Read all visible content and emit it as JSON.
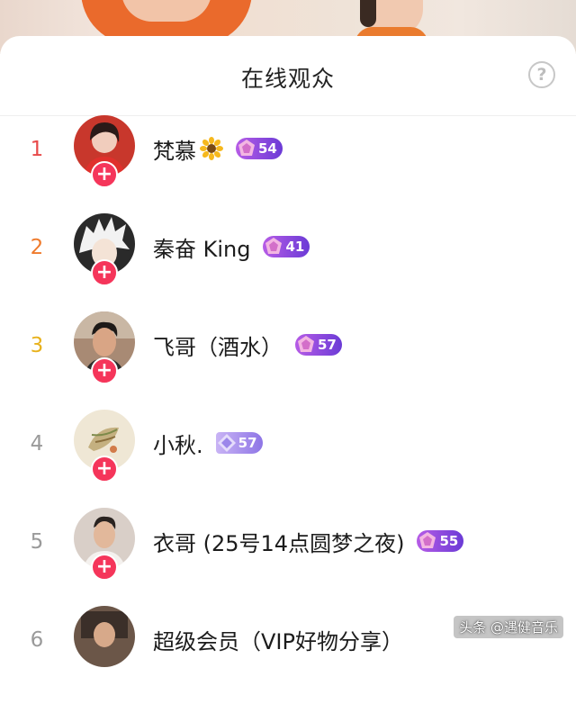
{
  "sheet": {
    "title": "在线观众",
    "help_label": "?"
  },
  "viewers": [
    {
      "rank": "1",
      "rank_color": "#e84a4a",
      "name": "梵慕",
      "level": "54",
      "emoji": "sunflower-icon",
      "avatar_bg": "#c8372c"
    },
    {
      "rank": "2",
      "rank_color": "#ef7b2d",
      "name": "秦奋 King",
      "level": "41",
      "avatar_bg": "#d9d9d9"
    },
    {
      "rank": "3",
      "rank_color": "#e8b21d",
      "name": "飞哥（酒水）",
      "level": "57",
      "avatar_bg": "#8f6b57"
    },
    {
      "rank": "4",
      "rank_color": "#9a9a9a",
      "name": "小秋.",
      "level": "57",
      "avatar_bg": "#efe7d5"
    },
    {
      "rank": "5",
      "rank_color": "#9a9a9a",
      "name": "衣哥 (25号14点圆梦之夜)",
      "level": "55",
      "avatar_bg": "#d9cfc8"
    },
    {
      "rank": "6",
      "rank_color": "#9a9a9a",
      "name": "超级会员（VIP好物分享）",
      "level": "",
      "avatar_bg": "#6b5648"
    }
  ],
  "follow_label": "+",
  "watermark": "头条 @遇健音乐",
  "colors": {
    "follow": "#f5355a",
    "badge_start": "#b65ce6",
    "badge_end": "#6b3bd6"
  }
}
